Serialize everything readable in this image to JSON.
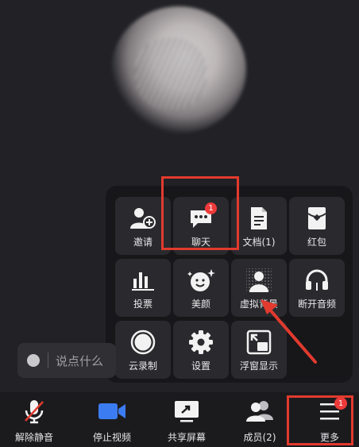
{
  "chat": {
    "placeholder": "说点什么"
  },
  "menu": {
    "row1": [
      {
        "label": "邀请",
        "icon": "invite-icon"
      },
      {
        "label": "聊天",
        "icon": "chat-icon",
        "badge": "1"
      },
      {
        "label": "文档(1)",
        "icon": "document-icon"
      },
      {
        "label": "红包",
        "icon": "red-packet-icon"
      }
    ],
    "row2": [
      {
        "label": "投票",
        "icon": "vote-chart-icon"
      },
      {
        "label": "美颜",
        "icon": "beauty-face-icon"
      },
      {
        "label": "虚拟背景",
        "icon": "virtual-background-icon"
      },
      {
        "label": "断开音频",
        "icon": "headphones-icon"
      }
    ],
    "row3": [
      {
        "label": "云录制",
        "icon": "cloud-record-icon"
      },
      {
        "label": "设置",
        "icon": "gear-icon"
      },
      {
        "label": "浮窗显示",
        "icon": "floating-window-icon"
      }
    ]
  },
  "toolbar": {
    "unmute": "解除静音",
    "stop_video": "停止视频",
    "share_screen": "共享屏幕",
    "members": "成员(2)",
    "more": "更多",
    "more_badge": "1"
  },
  "colors": {
    "background": "#222226",
    "menu_bg": "#17171a",
    "tile_bg": "#2a2a2e",
    "accent_blue": "#3c7cf2",
    "mic_muted_red": "#e23a2e",
    "badge_red": "#ee3a3a",
    "highlight_red": "#e23a2e"
  }
}
